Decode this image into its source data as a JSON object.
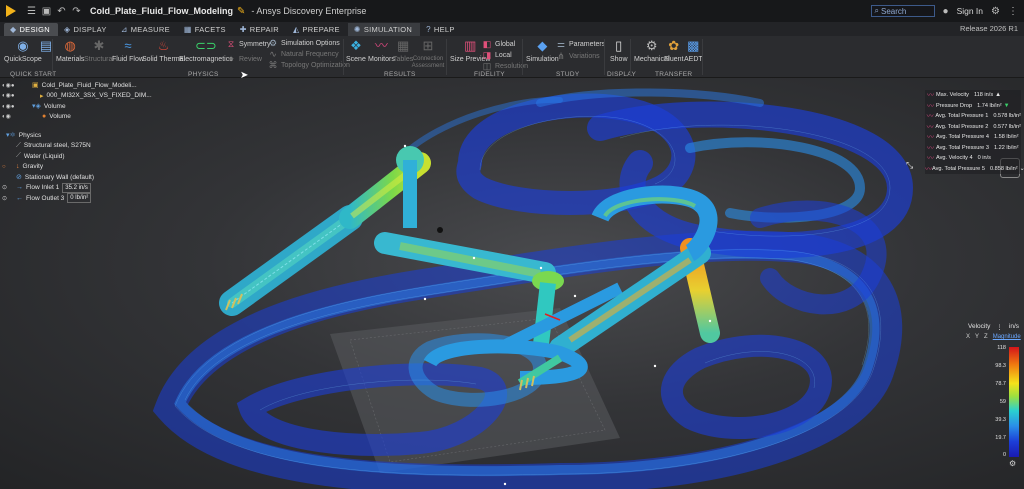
{
  "titlebar": {
    "document_title": "Cold_Plate_Fluid_Flow_Modeling",
    "app_title": "- Ansys Discovery Enterprise",
    "search_placeholder": "Search",
    "sign_in": "Sign In",
    "release": "Release 2026 R1"
  },
  "tabs": [
    {
      "label": "Design",
      "icon": "design-icon"
    },
    {
      "label": "Display",
      "icon": "display-icon"
    },
    {
      "label": "Measure",
      "icon": "ruler-icon"
    },
    {
      "label": "Facets",
      "icon": "facets-icon"
    },
    {
      "label": "Repair",
      "icon": "repair-icon"
    },
    {
      "label": "Prepare",
      "icon": "prepare-icon"
    },
    {
      "label": "Simulation",
      "icon": "simulation-icon"
    },
    {
      "label": "Help",
      "icon": "help-icon"
    }
  ],
  "ribbon": {
    "quick_start": {
      "label": "QuickScope",
      "group": "Quick Start"
    },
    "physics": {
      "group": "Physics",
      "materials": "Materials",
      "structural": "Structural",
      "fluid_flow": "Fluid Flow",
      "solid_thermal": "Solid Thermal",
      "electromagnetics": "Electromagnetics",
      "symmetry": "Symmetry",
      "review": "Review",
      "simulation_options": "Simulation Options",
      "natural_frequency": "Natural Frequency",
      "topology_optimization": "Topology Optimization"
    },
    "results": {
      "group": "Results",
      "scene": "Scene",
      "monitors": "Monitors",
      "tables": "Tables",
      "connection_assessment": "Connection Assessment"
    },
    "fidelity": {
      "group": "Fidelity",
      "size_preview": "Size Preview",
      "global": "Global",
      "local": "Local",
      "resolution": "Resolution"
    },
    "study": {
      "group": "Study",
      "simulation": "Simulation",
      "parameters": "Parameters",
      "variations": "Variations"
    },
    "display": {
      "group": "Display",
      "show": "Show"
    },
    "transfer": {
      "group": "Transfer",
      "mechanical": "Mechanical",
      "fluent": "Fluent",
      "aedt": "AEDT"
    }
  },
  "tree": {
    "items": [
      {
        "label": "Cold_Plate_Fluid_Flow_Modeli...",
        "indent": 1,
        "icon": "document-icon"
      },
      {
        "label": "000_MI32X_3SX_VS_FIXED_DIM...",
        "indent": 2,
        "icon": "component-icon"
      },
      {
        "label": "Volume",
        "indent": 3,
        "icon": "volume-icon"
      },
      {
        "label": "Volume",
        "indent": 4,
        "icon": "volume-body-icon"
      }
    ],
    "physics": [
      {
        "label": "Physics",
        "icon": "physics-icon",
        "value": ""
      },
      {
        "label": "Structural steel, S275N",
        "icon": "material-icon",
        "value": ""
      },
      {
        "label": "Water (Liquid)",
        "icon": "material-icon",
        "value": ""
      },
      {
        "label": "Gravity",
        "icon": "gravity-icon",
        "value": ""
      },
      {
        "label": "Stationary Wall (default)",
        "icon": "wall-icon",
        "value": ""
      },
      {
        "label": "Flow Inlet 1",
        "icon": "inlet-icon",
        "value": "35.2 in/s"
      },
      {
        "label": "Flow Outlet 3",
        "icon": "outlet-icon",
        "value": "0 lb/in²"
      }
    ]
  },
  "monitors": [
    {
      "label": "Max. Velocity",
      "value": "118 in/s",
      "trend": "up"
    },
    {
      "label": "Pressure Drop",
      "value": "1.74 lb/in²",
      "trend": "down"
    },
    {
      "label": "Avg. Total Pressure 1",
      "value": "0.578 lb/in²",
      "trend": ""
    },
    {
      "label": "Avg. Total Pressure 2",
      "value": "0.577 lb/in²",
      "trend": ""
    },
    {
      "label": "Avg. Total Pressure 4",
      "value": "1.58 lb/in²",
      "trend": ""
    },
    {
      "label": "Avg. Total Pressure 3",
      "value": "1.22 lb/in²",
      "trend": ""
    },
    {
      "label": "Avg. Velocity 4",
      "value": "0 in/s",
      "trend": ""
    },
    {
      "label": "Avg. Total Pressure 5",
      "value": "0.858 lb/in²",
      "trend": ""
    }
  ],
  "legend": {
    "title": "Velocity",
    "unit": "in/s",
    "axes": [
      "X",
      "Y",
      "Z"
    ],
    "mode": "Magnitude",
    "ticks": [
      "118",
      "98.3",
      "78.7",
      "59",
      "39.3",
      "19.7",
      "0"
    ]
  },
  "colors": {
    "accent": "#3d5a8a",
    "monitor_icon": "#d9487e",
    "trend_down": "#3ad06a",
    "logo": "#f2b21a"
  }
}
